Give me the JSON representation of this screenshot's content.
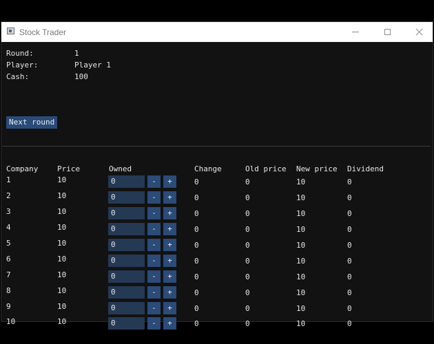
{
  "window": {
    "title": "Stock Trader",
    "controls": {
      "minimize": "minimize",
      "maximize": "maximize",
      "close": "close"
    }
  },
  "status": {
    "round_label": "Round:",
    "round_value": "1",
    "player_label": "Player:",
    "player_value": "Player 1",
    "cash_label": "Cash:",
    "cash_value": "100"
  },
  "next_round_button": "Next round",
  "table": {
    "headers": [
      "Company",
      "Price",
      "Owned",
      "Change",
      "Old price",
      "New price",
      "Dividend"
    ],
    "rows": [
      {
        "company": "1",
        "price": "10",
        "owned": "0",
        "minus": "-",
        "plus": "+",
        "change": "0",
        "old_price": "0",
        "new_price": "10",
        "dividend": "0"
      },
      {
        "company": "2",
        "price": "10",
        "owned": "0",
        "minus": "-",
        "plus": "+",
        "change": "0",
        "old_price": "0",
        "new_price": "10",
        "dividend": "0"
      },
      {
        "company": "3",
        "price": "10",
        "owned": "0",
        "minus": "-",
        "plus": "+",
        "change": "0",
        "old_price": "0",
        "new_price": "10",
        "dividend": "0"
      },
      {
        "company": "4",
        "price": "10",
        "owned": "0",
        "minus": "-",
        "plus": "+",
        "change": "0",
        "old_price": "0",
        "new_price": "10",
        "dividend": "0"
      },
      {
        "company": "5",
        "price": "10",
        "owned": "0",
        "minus": "-",
        "plus": "+",
        "change": "0",
        "old_price": "0",
        "new_price": "10",
        "dividend": "0"
      },
      {
        "company": "6",
        "price": "10",
        "owned": "0",
        "minus": "-",
        "plus": "+",
        "change": "0",
        "old_price": "0",
        "new_price": "10",
        "dividend": "0"
      },
      {
        "company": "7",
        "price": "10",
        "owned": "0",
        "minus": "-",
        "plus": "+",
        "change": "0",
        "old_price": "0",
        "new_price": "10",
        "dividend": "0"
      },
      {
        "company": "8",
        "price": "10",
        "owned": "0",
        "minus": "-",
        "plus": "+",
        "change": "0",
        "old_price": "0",
        "new_price": "10",
        "dividend": "0"
      },
      {
        "company": "9",
        "price": "10",
        "owned": "0",
        "minus": "-",
        "plus": "+",
        "change": "0",
        "old_price": "0",
        "new_price": "10",
        "dividend": "0"
      },
      {
        "company": "10",
        "price": "10",
        "owned": "0",
        "minus": "-",
        "plus": "+",
        "change": "0",
        "old_price": "0",
        "new_price": "10",
        "dividend": "0"
      }
    ]
  },
  "colors": {
    "button_bg": "#2a4a78",
    "input_bg": "#243954",
    "window_bg": "#121212"
  }
}
